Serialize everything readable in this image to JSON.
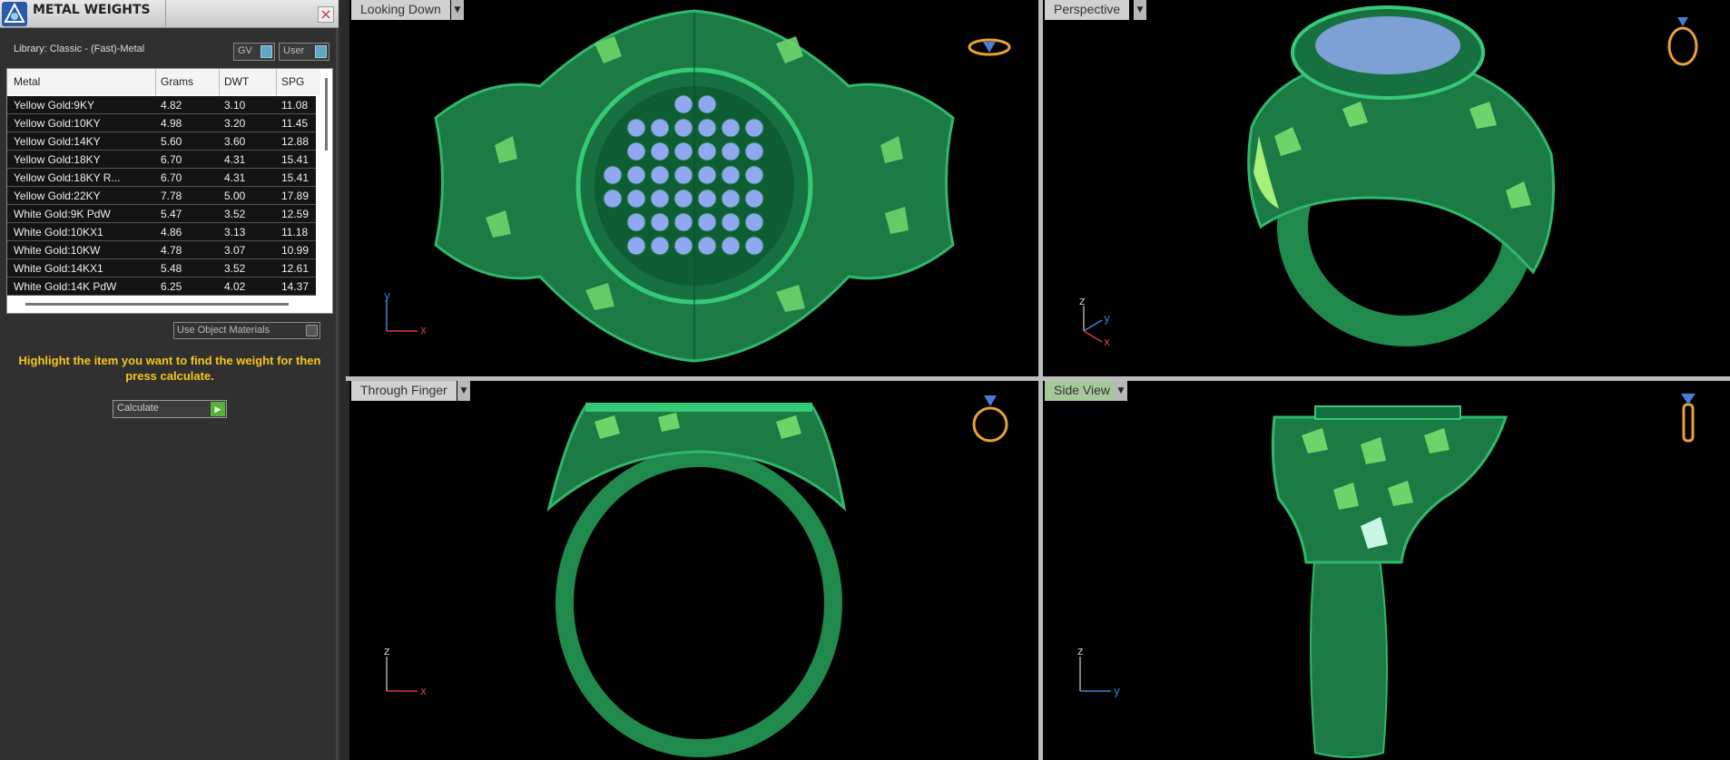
{
  "panel": {
    "title": "METAL WEIGHTS",
    "close_glyph": "×",
    "library_label": "Library: Classic - (Fast)-Metal",
    "toggle_gv": "GV",
    "toggle_user": "User",
    "use_object_materials": "Use Object Materials",
    "hint": "Highlight the item you want to find the weight for then press calculate.",
    "calculate_label": "Calculate",
    "calculate_icon": "play-icon",
    "hint_color": "#f5c61e"
  },
  "table": {
    "columns": [
      "Metal",
      "Grams",
      "DWT",
      "SPG"
    ],
    "rows": [
      [
        "Yellow Gold:9KY",
        "4.82",
        "3.10",
        "11.08"
      ],
      [
        "Yellow Gold:10KY",
        "4.98",
        "3.20",
        "11.45"
      ],
      [
        "Yellow Gold:14KY",
        "5.60",
        "3.60",
        "12.88"
      ],
      [
        "Yellow Gold:18KY",
        "6.70",
        "4.31",
        "15.41"
      ],
      [
        "Yellow Gold:18KY R...",
        "6.70",
        "4.31",
        "15.41"
      ],
      [
        "Yellow Gold:22KY",
        "7.78",
        "5.00",
        "17.89"
      ],
      [
        "White Gold:9K PdW",
        "5.47",
        "3.52",
        "12.59"
      ],
      [
        "White Gold:10KX1",
        "4.86",
        "3.13",
        "11.18"
      ],
      [
        "White Gold:10KW",
        "4.78",
        "3.07",
        "10.99"
      ],
      [
        "White Gold:14KX1",
        "5.48",
        "3.52",
        "12.61"
      ],
      [
        "White Gold:14K PdW",
        "6.25",
        "4.02",
        "14.37"
      ]
    ]
  },
  "viewports": {
    "top_left": {
      "label": "Looking Down",
      "axis_a": "y",
      "axis_b": "x"
    },
    "top_right": {
      "label": "Perspective",
      "axis_z": "z",
      "axis_y": "y",
      "axis_x": "x"
    },
    "bot_left": {
      "label": "Through Finger",
      "axis_a": "z",
      "axis_b": "x"
    },
    "bot_right": {
      "label": "Side View",
      "axis_a": "z",
      "axis_b": "y"
    },
    "dropdown_glyph": "▼"
  },
  "colors": {
    "metal": "#1f8a4c",
    "metal_light": "#7fe07a",
    "gem": "#8fa8f0",
    "active_view": "#a6c99a"
  }
}
